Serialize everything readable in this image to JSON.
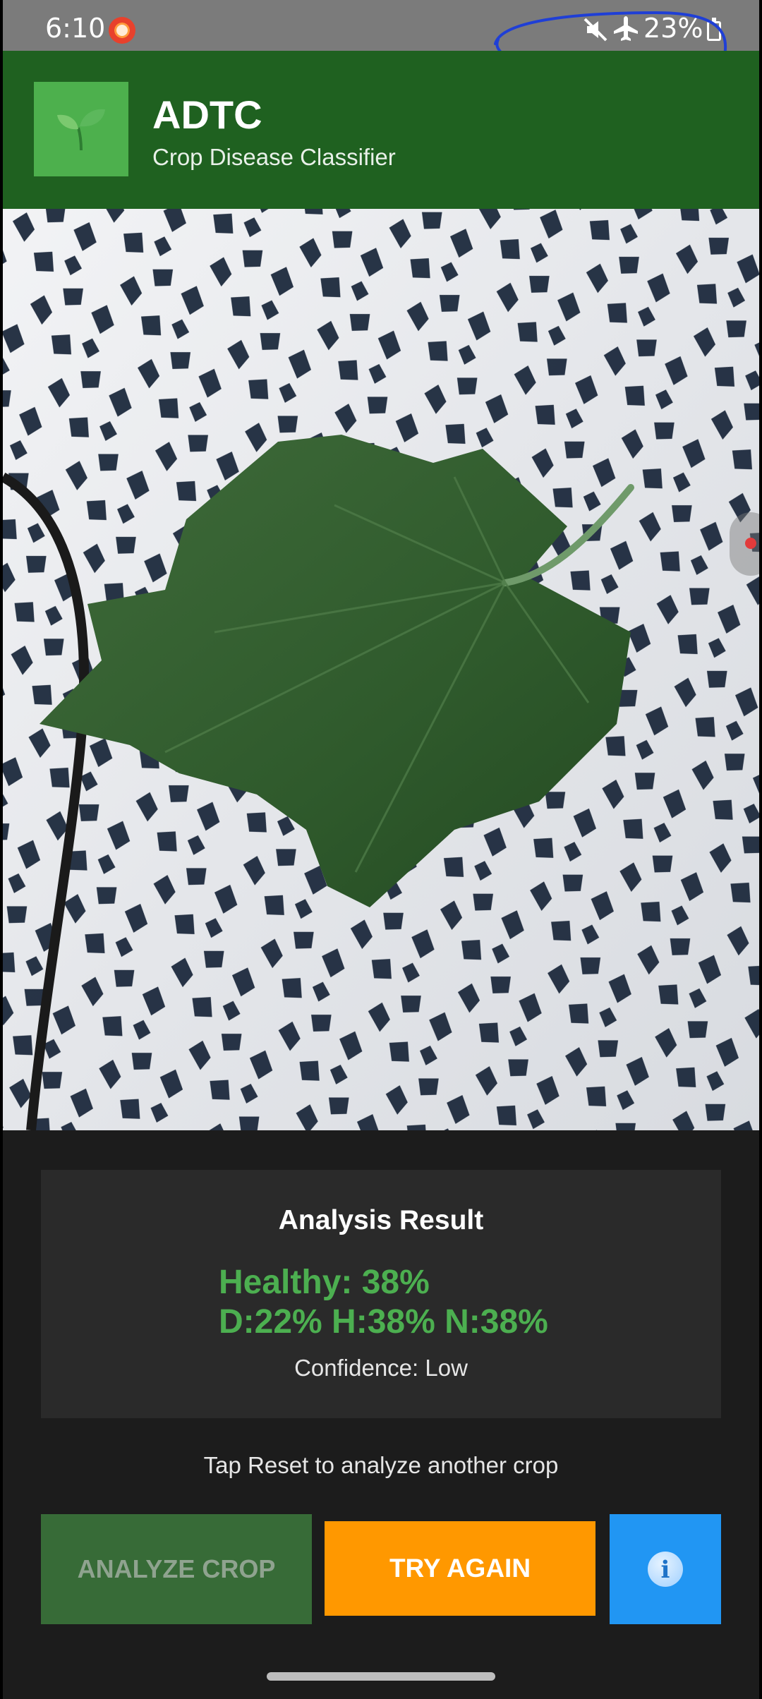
{
  "status_bar": {
    "time": "6:10",
    "battery": "23%",
    "icons": [
      "screen-record-icon",
      "mute-icon",
      "airplane-mode-icon",
      "battery-icon"
    ]
  },
  "header": {
    "logo_icon": "seedling-icon",
    "title": "ADTC",
    "subtitle": "Crop Disease Classifier"
  },
  "result": {
    "title": "Analysis Result",
    "line1": "Healthy: 38%",
    "line2": "D:22% H:38% N:38%",
    "confidence": "Confidence: Low"
  },
  "hint": "Tap Reset to analyze another crop",
  "buttons": {
    "analyze": "ANALYZE CROP",
    "try_again": "TRY AGAIN",
    "info_icon": "info-icon"
  },
  "colors": {
    "header_bg": "#1f6120",
    "result_green": "#4caf50",
    "try_again_bg": "#ff9800",
    "info_bg": "#2196f3",
    "analyze_bg": "#376b37"
  }
}
